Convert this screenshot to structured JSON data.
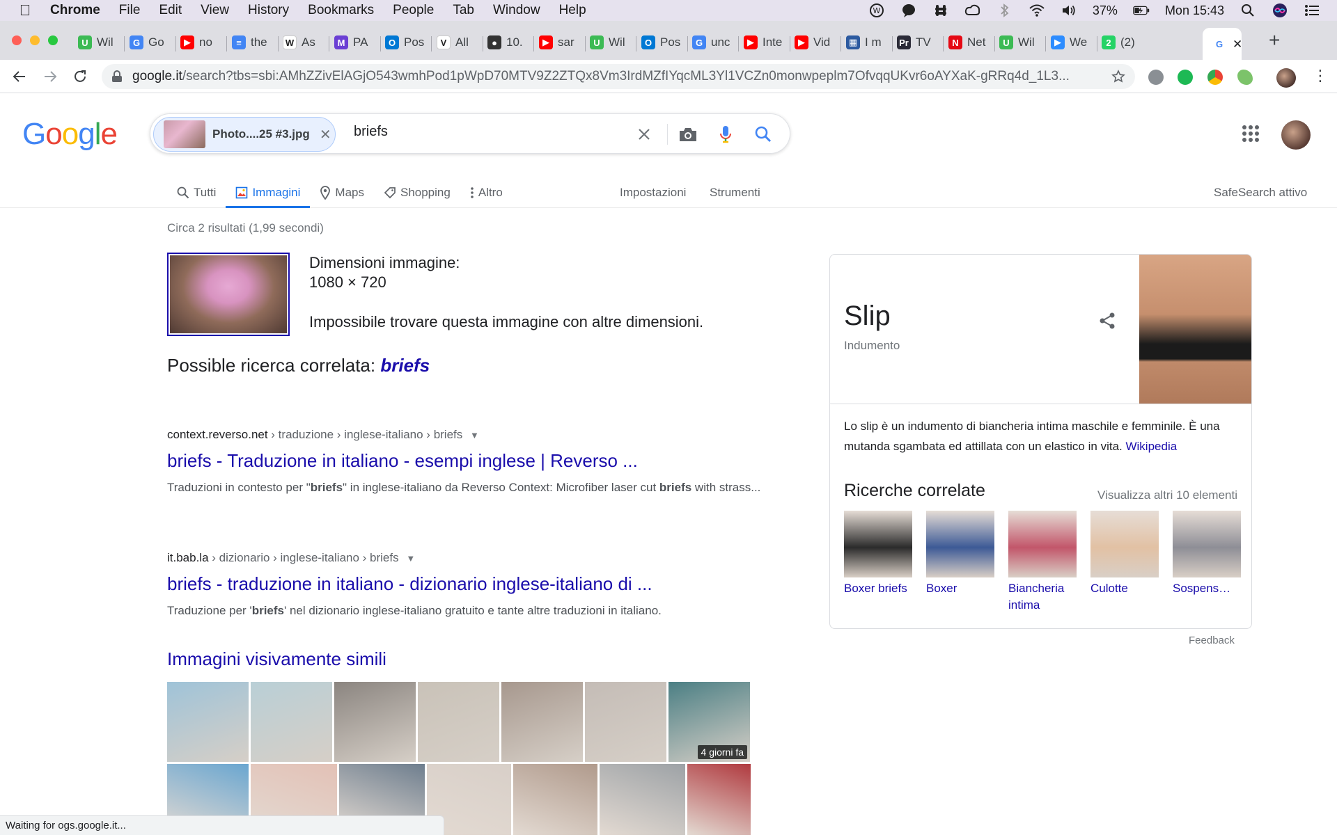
{
  "mac_menu": {
    "app": "Chrome",
    "items": [
      "File",
      "Edit",
      "View",
      "History",
      "Bookmarks",
      "People",
      "Tab",
      "Window",
      "Help"
    ],
    "battery": "37%",
    "clock": "Mon 15:43"
  },
  "tabs": [
    {
      "label": "Wil",
      "fav_color": "#3cba54",
      "fav_glyph": "U"
    },
    {
      "label": "Go",
      "fav_color": "#4285f4",
      "fav_glyph": "G"
    },
    {
      "label": "no",
      "fav_color": "#ff0000",
      "fav_glyph": "▶"
    },
    {
      "label": "the",
      "fav_color": "#4285f4",
      "fav_glyph": "≡"
    },
    {
      "label": "As",
      "fav_color": "#ffffff",
      "fav_glyph": "W"
    },
    {
      "label": "PA",
      "fav_color": "#6b3fd4",
      "fav_glyph": "M"
    },
    {
      "label": "Pos",
      "fav_color": "#0078d4",
      "fav_glyph": "O"
    },
    {
      "label": "All",
      "fav_color": "#ffffff",
      "fav_glyph": "V"
    },
    {
      "label": "10.",
      "fav_color": "#333333",
      "fav_glyph": "●"
    },
    {
      "label": "sar",
      "fav_color": "#ff0000",
      "fav_glyph": "▶"
    },
    {
      "label": "Wil",
      "fav_color": "#3cba54",
      "fav_glyph": "U"
    },
    {
      "label": "Pos",
      "fav_color": "#0078d4",
      "fav_glyph": "O"
    },
    {
      "label": "unc",
      "fav_color": "#4285f4",
      "fav_glyph": "G"
    },
    {
      "label": "Inte",
      "fav_color": "#ff0000",
      "fav_glyph": "▶"
    },
    {
      "label": "Vid",
      "fav_color": "#ff0000",
      "fav_glyph": "▶"
    },
    {
      "label": "I m",
      "fav_color": "#2c5aa0",
      "fav_glyph": "▦"
    },
    {
      "label": "TV",
      "fav_color": "#2b2b38",
      "fav_glyph": "Pr"
    },
    {
      "label": "Net",
      "fav_color": "#e50914",
      "fav_glyph": "N"
    },
    {
      "label": "Wil",
      "fav_color": "#3cba54",
      "fav_glyph": "U"
    },
    {
      "label": "We",
      "fav_color": "#2d8cff",
      "fav_glyph": "▶"
    },
    {
      "label": "(2)",
      "fav_color": "#25d366",
      "fav_glyph": "2"
    }
  ],
  "active_tab": {
    "fav_glyph": "G",
    "close": "✕"
  },
  "new_tab": "+",
  "address": {
    "host": "google.it",
    "path": "/search?tbs=sbi:AMhZZivElAGjO543wmhPod1pWpD70MTV9Z2ZTQx8Vm3IrdMZfIYqcML3Yl1VCZn0monwpeplm7OfvqqUKvr6oAYXaK-gRRq4d_1L3..."
  },
  "search": {
    "chip_name": "Photo....25 #3.jpg",
    "query": "briefs"
  },
  "nav_tabs": [
    {
      "label": "Tutti",
      "icon": "search-icon"
    },
    {
      "label": "Immagini",
      "icon": "image-icon"
    },
    {
      "label": "Maps",
      "icon": "pin-icon"
    },
    {
      "label": "Shopping",
      "icon": "tag-icon"
    },
    {
      "label": "Altro",
      "icon": "more-vert-icon"
    }
  ],
  "tools": {
    "settings": "Impostazioni",
    "tools": "Strumenti",
    "safesearch": "SafeSearch attivo"
  },
  "stats": "Circa 2 risultati (1,99 secondi)",
  "image_info": {
    "dim_label": "Dimensioni immagine:",
    "dim_value": "1080 × 720",
    "no_other": "Impossibile trovare questa immagine con altre dimensioni."
  },
  "possible": {
    "label": "Possible ricerca correlata:",
    "term": "briefs"
  },
  "results": [
    {
      "site": "context.reverso.net",
      "crumbs": " › traduzione › inglese-italiano › briefs",
      "title": "briefs - Traduzione in italiano - esempi inglese | Reverso ...",
      "snippet_html": "Traduzioni in contesto per \"<b>briefs</b>\" in inglese-italiano da Reverso Context: Microfiber laser cut <b>briefs</b> with strass..."
    },
    {
      "site": "it.bab.la",
      "crumbs": " › dizionario › inglese-italiano › briefs",
      "title": "briefs - traduzione in italiano - dizionario inglese-italiano di ...",
      "snippet_html": "Traduzione per '<b>briefs</b>' nel dizionario inglese-italiano gratuito e tante altre traduzioni in italiano."
    }
  ],
  "similar": {
    "heading": "Immagini visivamente simili",
    "badge": "4 giorni fa",
    "row1": [
      "#9fc3d8",
      "#b9cfd6",
      "#8b8580",
      "#c9c2b8",
      "#a7988e",
      "#c4bcb6",
      "#4b7f84"
    ],
    "row2": [
      "#6aa6d0",
      "#e3c1b6",
      "#6e7e8e",
      "#d8cfc8",
      "#b09a8c",
      "#9da2a6",
      "#b03a3f"
    ]
  },
  "knowledge_panel": {
    "title": "Slip",
    "subtitle": "Indumento",
    "description": "Lo slip è un indumento di biancheria intima maschile e femminile. È una mutanda sgambata ed attillata con un elastico in vita.",
    "source": "Wikipedia",
    "related_heading": "Ricerche correlate",
    "more": "Visualizza altri 10 elementi",
    "items": [
      {
        "label": "Boxer briefs",
        "color": "#2b2b2b"
      },
      {
        "label": "Boxer",
        "color": "#3d5a96"
      },
      {
        "label": "Biancheria intima",
        "color": "#c2566a"
      },
      {
        "label": "Culotte",
        "color": "#e2c1a4"
      },
      {
        "label": "Sospens…",
        "color": "#8e8e96"
      }
    ]
  },
  "feedback": "Feedback",
  "status": "Waiting for ogs.google.it..."
}
